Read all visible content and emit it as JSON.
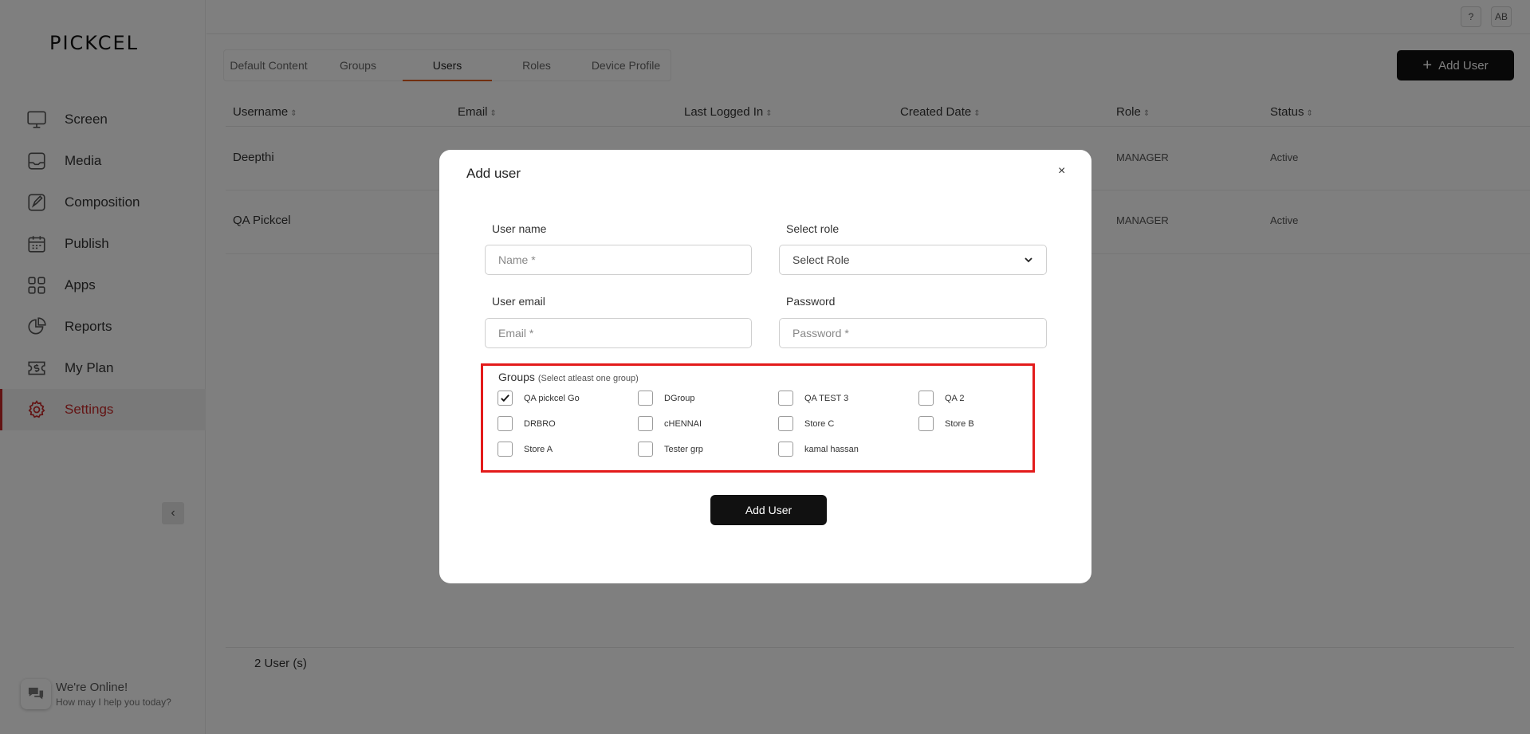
{
  "brand": {
    "logo_text": "PICKCEL"
  },
  "sidebar": {
    "items": [
      {
        "label": "Screen",
        "icon": "monitor-icon"
      },
      {
        "label": "Media",
        "icon": "media-icon"
      },
      {
        "label": "Composition",
        "icon": "composition-icon"
      },
      {
        "label": "Publish",
        "icon": "calendar-icon"
      },
      {
        "label": "Apps",
        "icon": "apps-grid-icon"
      },
      {
        "label": "Reports",
        "icon": "pie-chart-icon"
      },
      {
        "label": "My Plan",
        "icon": "dollar-ticket-icon"
      },
      {
        "label": "Settings",
        "icon": "gear-icon"
      }
    ],
    "active_item": "Settings",
    "active_color": "#c62828"
  },
  "topbar": {
    "help_label": "?",
    "avatar_initials": "AB"
  },
  "tabs": [
    "Default Content",
    "Groups",
    "Users",
    "Roles",
    "Device Profile"
  ],
  "active_tab": "Users",
  "add_user_button_label": "Add User",
  "table": {
    "columns": [
      "Username",
      "Email",
      "Last Logged In",
      "Created Date",
      "Role",
      "Status"
    ],
    "rows": [
      {
        "username": "Deepthi",
        "role": "MANAGER",
        "status": "Active"
      },
      {
        "username": "QA Pickcel",
        "role": "MANAGER",
        "status": "Active"
      }
    ],
    "count_label": "2 User (s)"
  },
  "chat": {
    "title": "We're Online!",
    "subtitle": "How may I help you today?"
  },
  "modal": {
    "title": "Add user",
    "close_label": "×",
    "username_label": "User name",
    "username_placeholder": "Name *",
    "role_label": "Select role",
    "role_value": "Select Role",
    "email_label": "User email",
    "email_placeholder": "Email *",
    "password_label": "Password",
    "password_placeholder": "Password *",
    "groups_title": "Groups",
    "groups_hint": "(Select atleast one group)",
    "groups": [
      {
        "label": "QA pickcel Go",
        "checked": true
      },
      {
        "label": "DGroup",
        "checked": false
      },
      {
        "label": "QA TEST 3",
        "checked": false
      },
      {
        "label": "QA 2",
        "checked": false
      },
      {
        "label": "DRBRO",
        "checked": false
      },
      {
        "label": "cHENNAI",
        "checked": false
      },
      {
        "label": "Store C",
        "checked": false
      },
      {
        "label": "Store B",
        "checked": false
      },
      {
        "label": "Store A",
        "checked": false
      },
      {
        "label": "Tester grp",
        "checked": false
      },
      {
        "label": "kamal hassan",
        "checked": false
      }
    ],
    "submit_label": "Add User",
    "highlight_color": "#e31b1b"
  }
}
